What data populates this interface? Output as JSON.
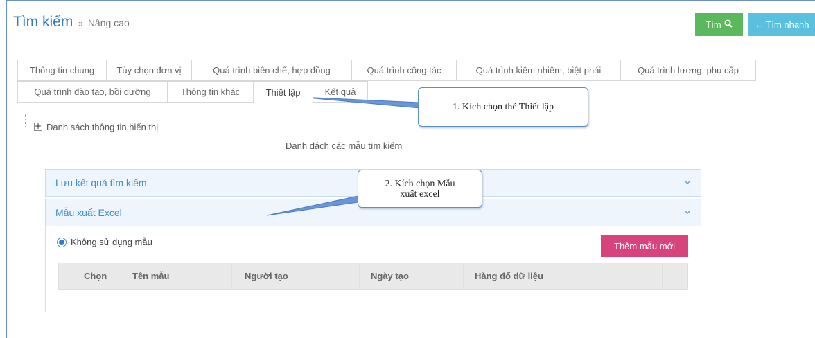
{
  "header": {
    "title": "Tìm kiếm",
    "separator": "»",
    "subtitle": "Nâng cao",
    "search_button": "Tìm",
    "quick_search_button": "← Tìm nhanh"
  },
  "tabs_row1": [
    "Thông tin chung",
    "Tùy chọn đơn vị",
    "Quá trình biên chế, hợp đồng",
    "Quá trình công tác",
    "Quá trình kiêm nhiệm, biệt phái",
    "Quá trình lương, phụ cấp"
  ],
  "tabs_row2": [
    "Quá trình đào tạo, bồi dưỡng",
    "Thông tin khác",
    "Thiết lập",
    "Kết quả"
  ],
  "active_tab": "Thiết lập",
  "tree": {
    "expand_symbol": "+",
    "label": "Danh sách thông tin hiển thị"
  },
  "list_title": "Danh dách các mẫu tìm kiếm",
  "panels": {
    "save_results": "Lưu kết quả tìm kiếm",
    "excel_template": "Mẫu xuất Excel"
  },
  "excel_body": {
    "radio_label": "Không sử dụng mẫu",
    "radio_checked": true,
    "add_button": "Thêm mẫu mới",
    "columns": [
      "Chọn",
      "Tên mẫu",
      "Người tạo",
      "Ngày tạo",
      "Hàng đổ dữ liệu",
      ""
    ]
  },
  "callouts": {
    "step1": "1. Kích chọn thẻ Thiết lập",
    "step2_line1": "2. Kích chọn Mẫu",
    "step2_line2": "xuất excel"
  },
  "icons": {
    "search": "search-icon",
    "chevron": "chevron-down-icon",
    "expand": "plus-box-icon"
  },
  "colors": {
    "title_blue": "#2f7dc2",
    "search_green": "#5cb85c",
    "quick_cyan": "#5bc0de",
    "add_pink": "#d9437c",
    "panel_head_bg": "#eef5fc"
  }
}
